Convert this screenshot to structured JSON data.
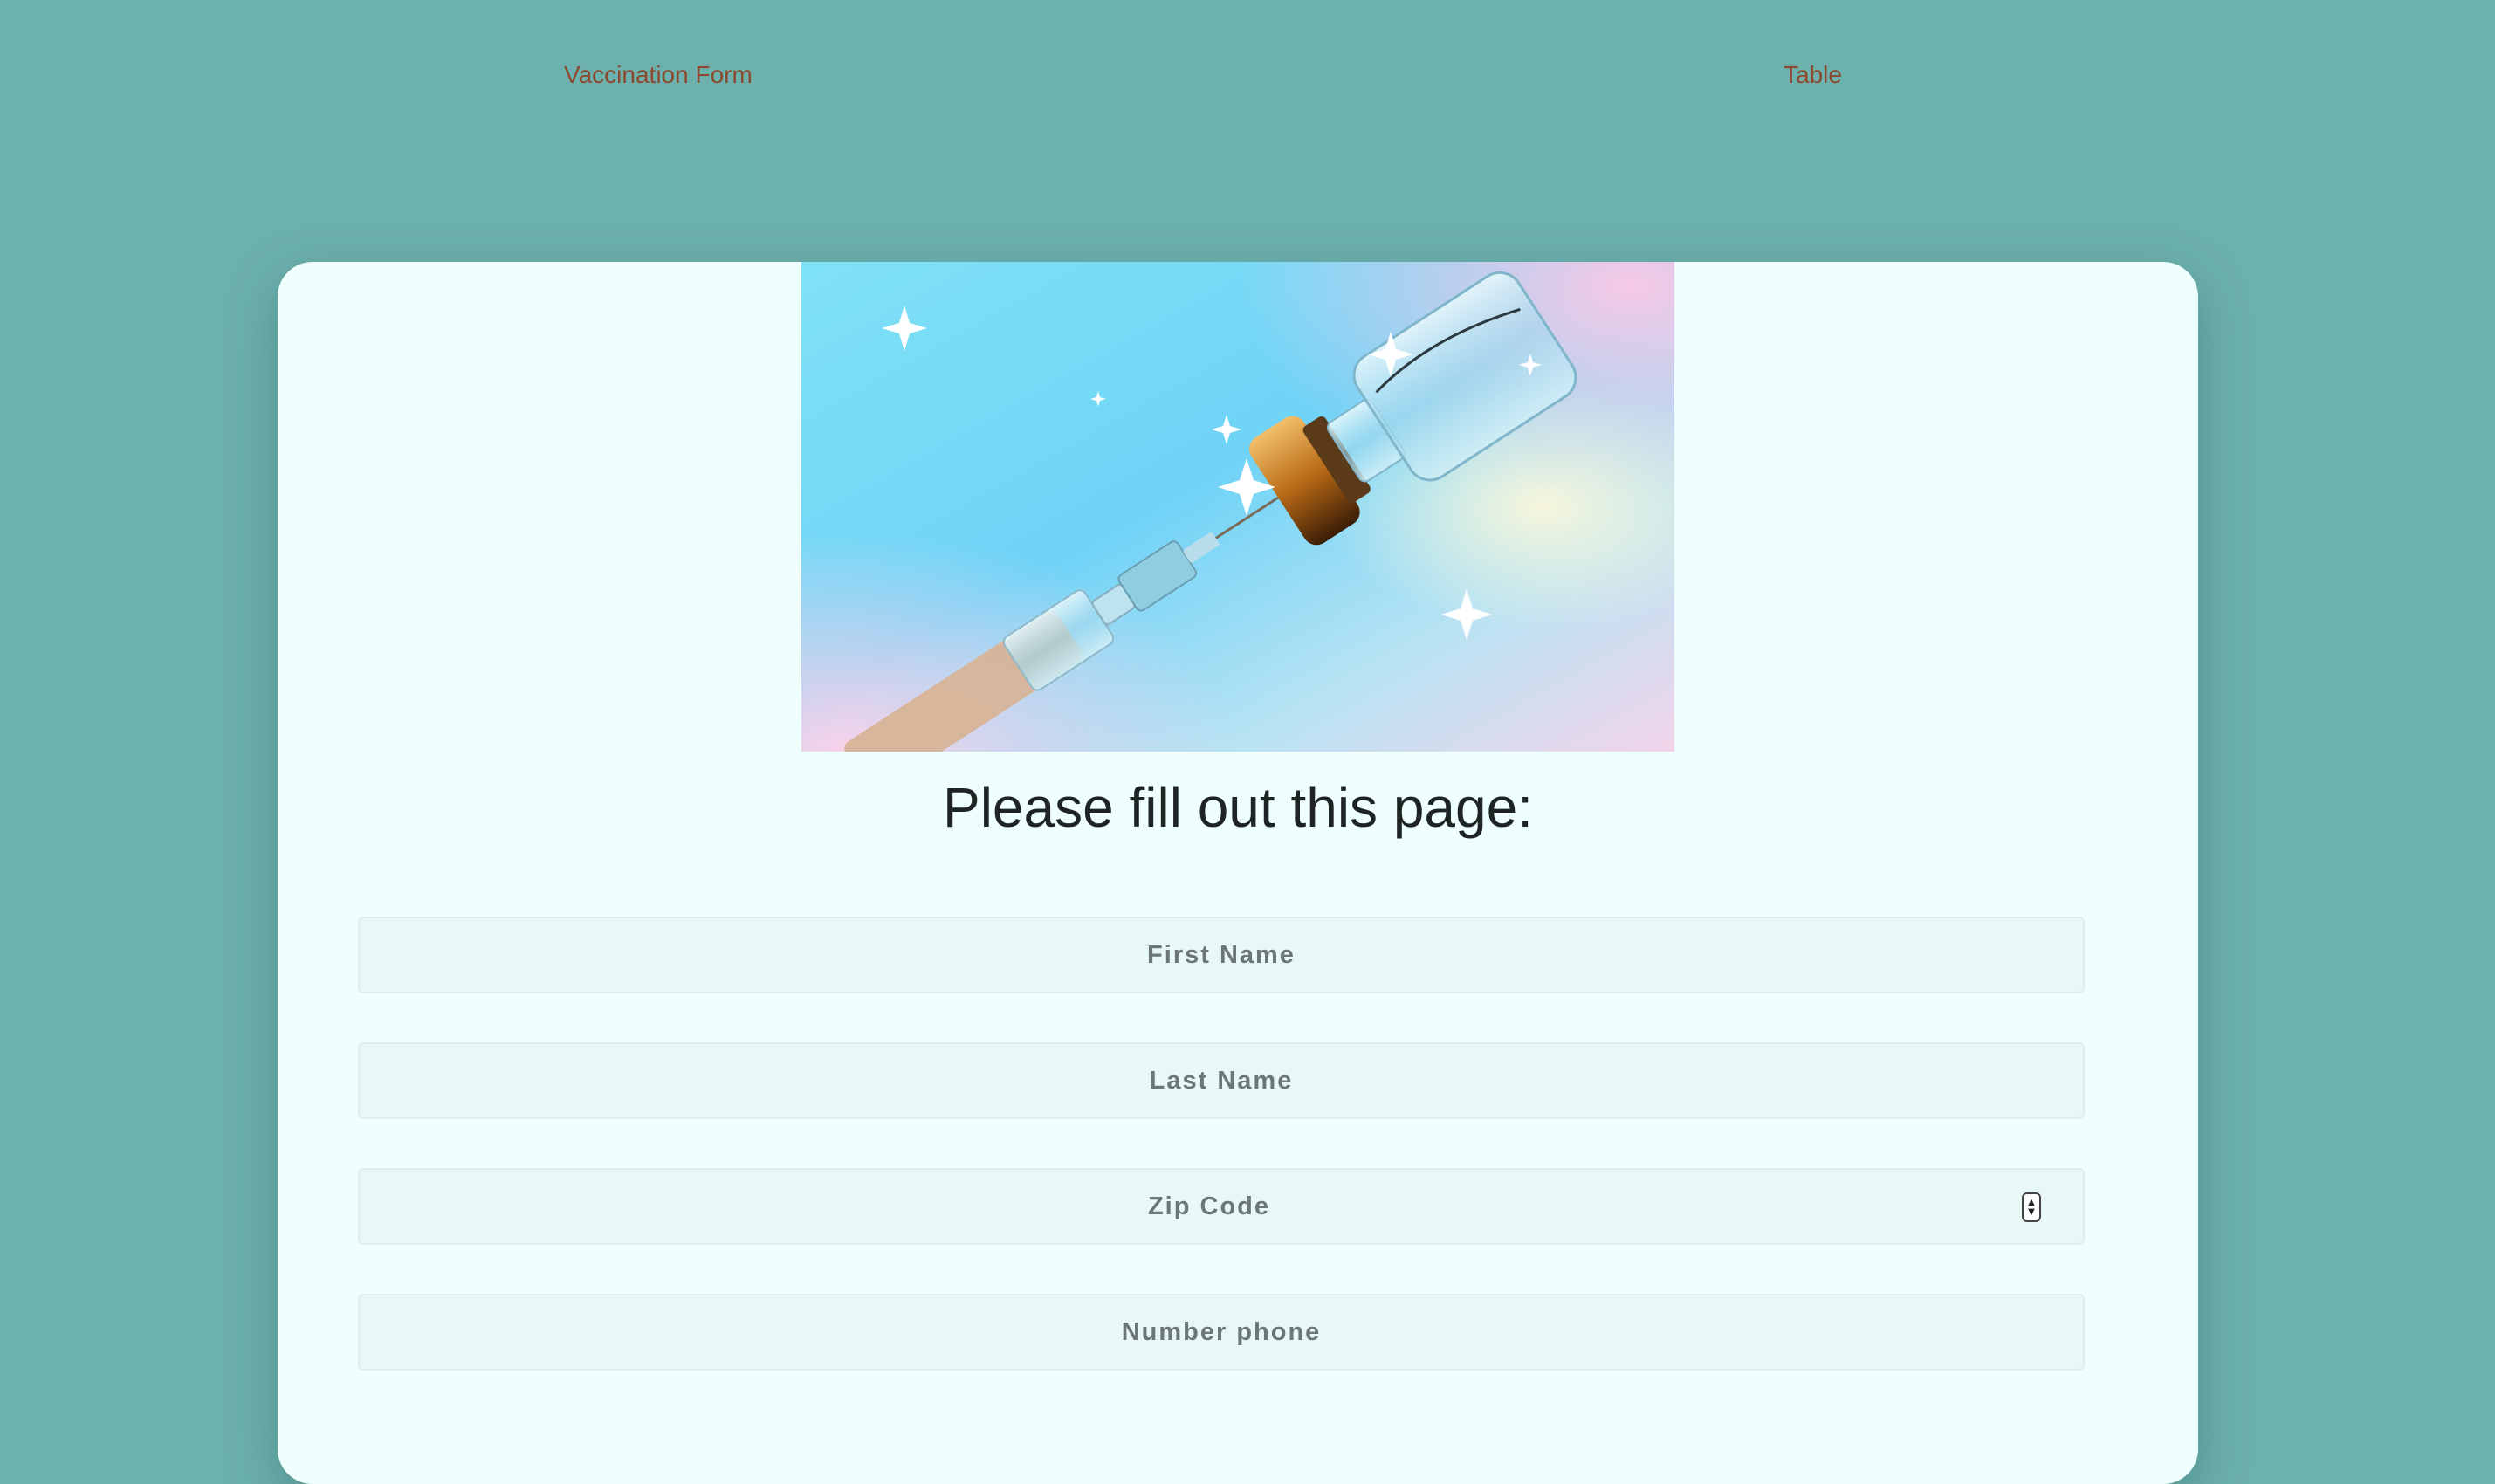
{
  "nav": {
    "links": [
      {
        "label": "Vaccination Form"
      },
      {
        "label": "Table"
      }
    ]
  },
  "hero": {
    "icon": "vaccine-vial-syringe-image"
  },
  "form": {
    "title": "Please fill out this page:",
    "fields": [
      {
        "placeholder": "First Name",
        "value": ""
      },
      {
        "placeholder": "Last Name",
        "value": ""
      },
      {
        "placeholder": "Zip Code",
        "value": ""
      },
      {
        "placeholder": "Number phone",
        "value": ""
      }
    ]
  },
  "colors": {
    "background": "#6db1ae",
    "card": "#effffd",
    "nav_link": "#8b4a2f",
    "field_bg": "#e8f8f6",
    "field_text": "#6b7675"
  }
}
